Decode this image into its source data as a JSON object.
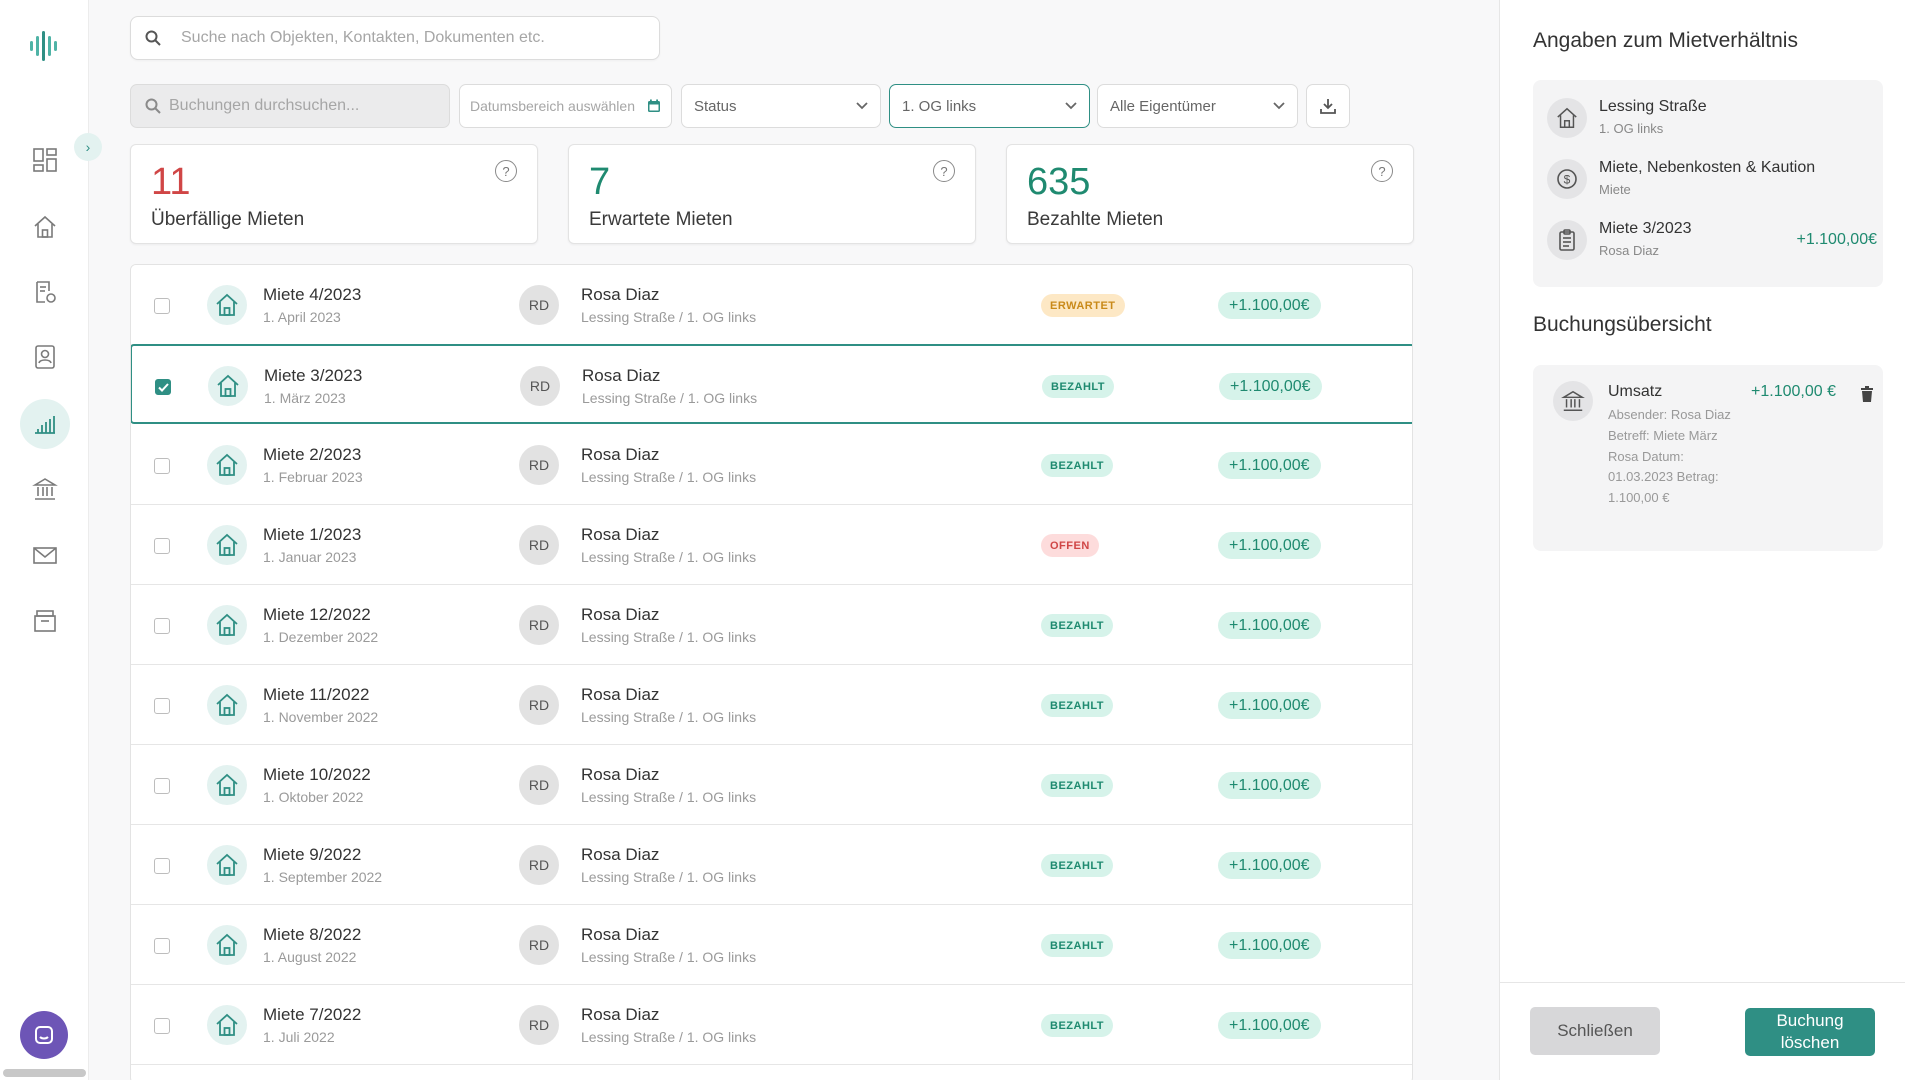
{
  "colors": {
    "accent": "#2f8f84",
    "overdue": "#d04646",
    "success": "#1f8a70",
    "paid_bg": "#d6f3ea"
  },
  "sidebar": {
    "items": [
      {
        "icon": "dashboard-icon"
      },
      {
        "icon": "home-icon"
      },
      {
        "icon": "document-settings-icon"
      },
      {
        "icon": "contact-book-icon"
      },
      {
        "icon": "bar-chart-icon",
        "active": true
      },
      {
        "icon": "bank-icon"
      },
      {
        "icon": "mail-icon"
      },
      {
        "icon": "archive-icon"
      }
    ],
    "collapse_glyph": "›"
  },
  "global_search": {
    "placeholder": "Suche nach Objekten, Kontakten, Dokumenten etc."
  },
  "filters": {
    "booking_search_placeholder": "Buchungen durchsuchen...",
    "date_range_placeholder": "Datumsbereich auswählen",
    "status": "Status",
    "unit": "1. OG links",
    "owner": "Alle Eigentümer"
  },
  "stats": [
    {
      "value": "11",
      "label": "Überfällige Mieten",
      "help": "?"
    },
    {
      "value": "7",
      "label": "Erwartete Mieten",
      "help": "?"
    },
    {
      "value": "635",
      "label": "Bezahlte Mieten",
      "help": "?"
    }
  ],
  "rows": [
    {
      "title": "Miete 4/2023",
      "date": "1. April 2023",
      "initials": "RD",
      "name": "Rosa Diaz",
      "sub": "Lessing Straße / 1. OG links",
      "status": "ERWARTET",
      "amount": "+1.100,00€"
    },
    {
      "title": "Miete 3/2023",
      "date": "1. März 2023",
      "initials": "RD",
      "name": "Rosa Diaz",
      "sub": "Lessing Straße / 1. OG links",
      "status": "BEZAHLT",
      "amount": "+1.100,00€",
      "selected": true
    },
    {
      "title": "Miete 2/2023",
      "date": "1. Februar 2023",
      "initials": "RD",
      "name": "Rosa Diaz",
      "sub": "Lessing Straße / 1. OG links",
      "status": "BEZAHLT",
      "amount": "+1.100,00€"
    },
    {
      "title": "Miete 1/2023",
      "date": "1. Januar 2023",
      "initials": "RD",
      "name": "Rosa Diaz",
      "sub": "Lessing Straße / 1. OG links",
      "status": "OFFEN",
      "amount": "+1.100,00€"
    },
    {
      "title": "Miete 12/2022",
      "date": "1. Dezember 2022",
      "initials": "RD",
      "name": "Rosa Diaz",
      "sub": "Lessing Straße / 1. OG links",
      "status": "BEZAHLT",
      "amount": "+1.100,00€"
    },
    {
      "title": "Miete 11/2022",
      "date": "1. November 2022",
      "initials": "RD",
      "name": "Rosa Diaz",
      "sub": "Lessing Straße / 1. OG links",
      "status": "BEZAHLT",
      "amount": "+1.100,00€"
    },
    {
      "title": "Miete 10/2022",
      "date": "1. Oktober 2022",
      "initials": "RD",
      "name": "Rosa Diaz",
      "sub": "Lessing Straße / 1. OG links",
      "status": "BEZAHLT",
      "amount": "+1.100,00€"
    },
    {
      "title": "Miete 9/2022",
      "date": "1. September 2022",
      "initials": "RD",
      "name": "Rosa Diaz",
      "sub": "Lessing Straße / 1. OG links",
      "status": "BEZAHLT",
      "amount": "+1.100,00€"
    },
    {
      "title": "Miete 8/2022",
      "date": "1. August 2022",
      "initials": "RD",
      "name": "Rosa Diaz",
      "sub": "Lessing Straße / 1. OG links",
      "status": "BEZAHLT",
      "amount": "+1.100,00€"
    },
    {
      "title": "Miete 7/2022",
      "date": "1. Juli 2022",
      "initials": "RD",
      "name": "Rosa Diaz",
      "sub": "Lessing Straße / 1. OG links",
      "status": "BEZAHLT",
      "amount": "+1.100,00€"
    }
  ],
  "panel": {
    "title": "Angaben zum Mietverhältnis",
    "property": {
      "title": "Lessing Straße",
      "sub": "1. OG links"
    },
    "category": {
      "title": "Miete, Nebenkosten & Kaution",
      "sub": "Miete"
    },
    "rent": {
      "title": "Miete 3/2023",
      "sub": "Rosa Diaz",
      "amount": "+1.100,00€"
    },
    "overview_title": "Buchungsübersicht",
    "booking": {
      "title": "Umsatz",
      "amount": "+1.100,00 €",
      "details": "Absender: Rosa Diaz Betreff: Miete März Rosa Datum: 01.03.2023 Betrag: 1.100,00 €"
    },
    "close_label": "Schließen",
    "delete_label": "Buchung löschen"
  }
}
